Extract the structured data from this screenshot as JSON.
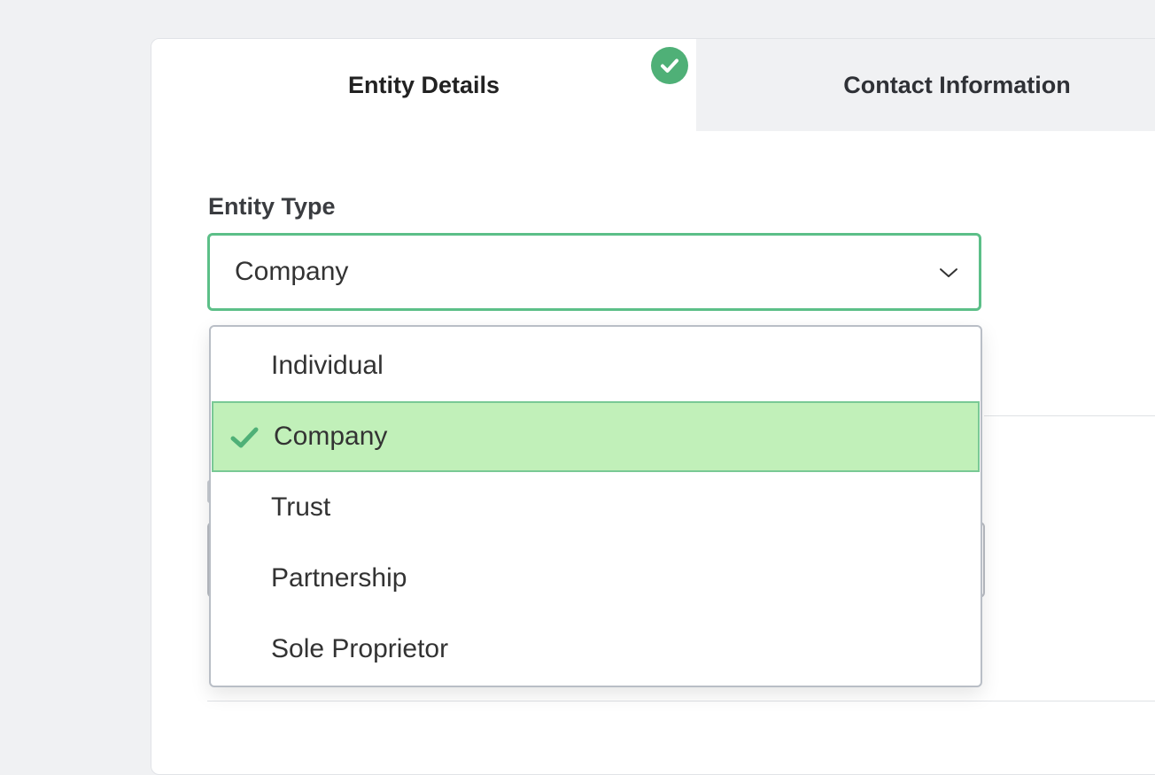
{
  "tabs": {
    "entity_details": "Entity Details",
    "contact_information": "Contact Information"
  },
  "entity_type": {
    "label": "Entity Type",
    "selected_value": "Company"
  },
  "dropdown": {
    "options": [
      {
        "label": "Individual",
        "selected": false
      },
      {
        "label": "Company",
        "selected": true
      },
      {
        "label": "Trust",
        "selected": false
      },
      {
        "label": "Partnership",
        "selected": false
      },
      {
        "label": "Sole Proprietor",
        "selected": false
      }
    ]
  },
  "icons": {
    "tab_status": "check-circle-icon",
    "select_arrow": "chevron-down-icon",
    "option_selected": "checkmark-icon"
  },
  "colors": {
    "accent_green": "#4fb077",
    "focus_border": "#5cbf88",
    "selected_option_bg": "#c1f0b9",
    "inactive_tab_bg": "#f0f1f3"
  }
}
